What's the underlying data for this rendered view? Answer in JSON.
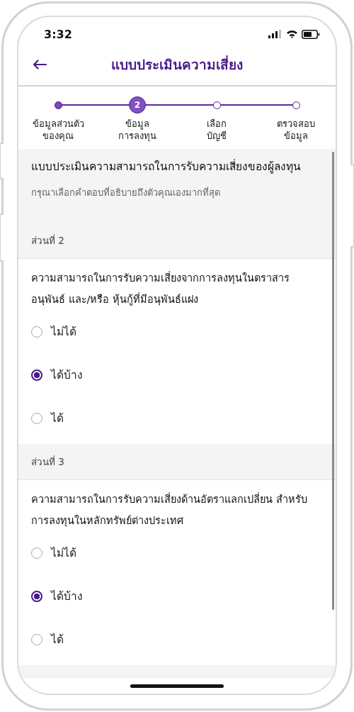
{
  "status_bar": {
    "time": "3:32"
  },
  "header": {
    "title": "แบบประเมินความเสี่ยง"
  },
  "stepper": [
    {
      "kind": "done",
      "label_lines": [
        "ข้อมูลส่วนตัว",
        "ของคุณ"
      ]
    },
    {
      "kind": "current",
      "number": "2",
      "label_lines": [
        "ข้อมูล",
        "การลงทุน"
      ]
    },
    {
      "kind": "pending",
      "label_lines": [
        "เลือก",
        "บัญชี"
      ]
    },
    {
      "kind": "pending",
      "label_lines": [
        "ตรวจสอบ",
        "ข้อมูล"
      ]
    }
  ],
  "intro": {
    "title": "แบบประเมินความสามารถในการรับความเสี่ยงของผู้ลงทุน",
    "subtitle": "กรุณาเลือกคำตอบที่อธิบายถึงตัวคุณเองมากที่สุด"
  },
  "sections": [
    {
      "label": "ส่วนที่ 2",
      "question": "ความสามารถในการรับความเสี่ยงจากการลงทุนในตราสารอนุพันธ์ และ/หรือ หุ้นกู้ที่มีอนุพันธ์แฝง",
      "options": [
        {
          "label": "ไม่ได้",
          "selected": false
        },
        {
          "label": "ได้บ้าง",
          "selected": true
        },
        {
          "label": "ได้",
          "selected": false
        }
      ]
    },
    {
      "label": "ส่วนที่ 3",
      "question": "ความสามารถในการรับความเสี่ยงด้านอัตราแลกเปลี่ยน สำหรับการลงทุนในหลักทรัพย์ต่างประเทศ",
      "options": [
        {
          "label": "ไม่ได้",
          "selected": false
        },
        {
          "label": "ได้บ้าง",
          "selected": true
        },
        {
          "label": "ได้",
          "selected": false
        }
      ]
    }
  ]
}
